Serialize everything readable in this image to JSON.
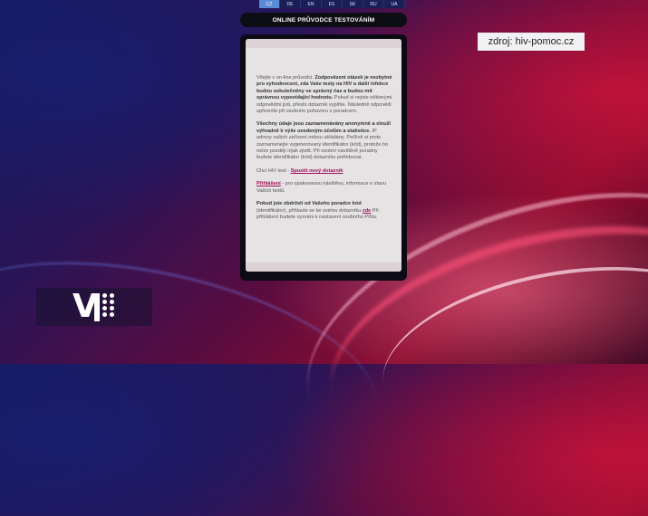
{
  "languages": [
    "CZ",
    "DE",
    "EN",
    "ES",
    "SK",
    "RU",
    "UA"
  ],
  "active_language": "CZ",
  "header": {
    "title": "ONLINE PRŮVODCE TESTOVÁNÍM"
  },
  "source_label": "zdroj: hiv-pomoc.cz",
  "content": {
    "p1_plain": "Vítejte v on-line průvodci. ",
    "p1_bold": "Zodpovězení otázek je nezbytné pro vyhodnocení, zda Vaše testy na HIV a další infekce budou uskutečněny ve správný čas a budou mít správnou vypovídající hodnotu.",
    "p1_rest": " Pokud si nejste některými odpovědmi jisti, přesto dotazník vyplňte. Následně odpovědi upřesníte při osobním pohovoru s poradcem.",
    "p2_bold": "Všechny údaje jsou zaznamenávány anonymně a slouží výhradně k výše uvedeným účelům a statistice.",
    "p2_rest": " IP adresy vašich zařízení nebou ukládány. Pečlivě si proto zaznamenejte vygenerovaný identifikátor (kód), protože ho nelze později nijak zjistit. Při osobní návštěvě poradny budete identifikátor (kód) dotazníku potřebovat.",
    "p3_text": "Chci HIV test - ",
    "p3_link": "Spustit nový dotazník",
    "p4_link": "Přihlášení",
    "p4_text": " - pro opakovanou návštěvu, informace o stavu Vašich testů.",
    "p5_bold": "Pokud jste obdrželi od Vašeho poradce kód",
    "p5_text": " (identifikátor), přihlaste se ke svému dotazníku ",
    "p5_link": "zde",
    "p5_rest": " Při přihlášení budete vyzváni k nastavení osobního PINu."
  },
  "logo": {
    "letter": "V"
  },
  "colors": {
    "accent_link": "#a0105a",
    "active_lang": "#5b8bd6"
  }
}
